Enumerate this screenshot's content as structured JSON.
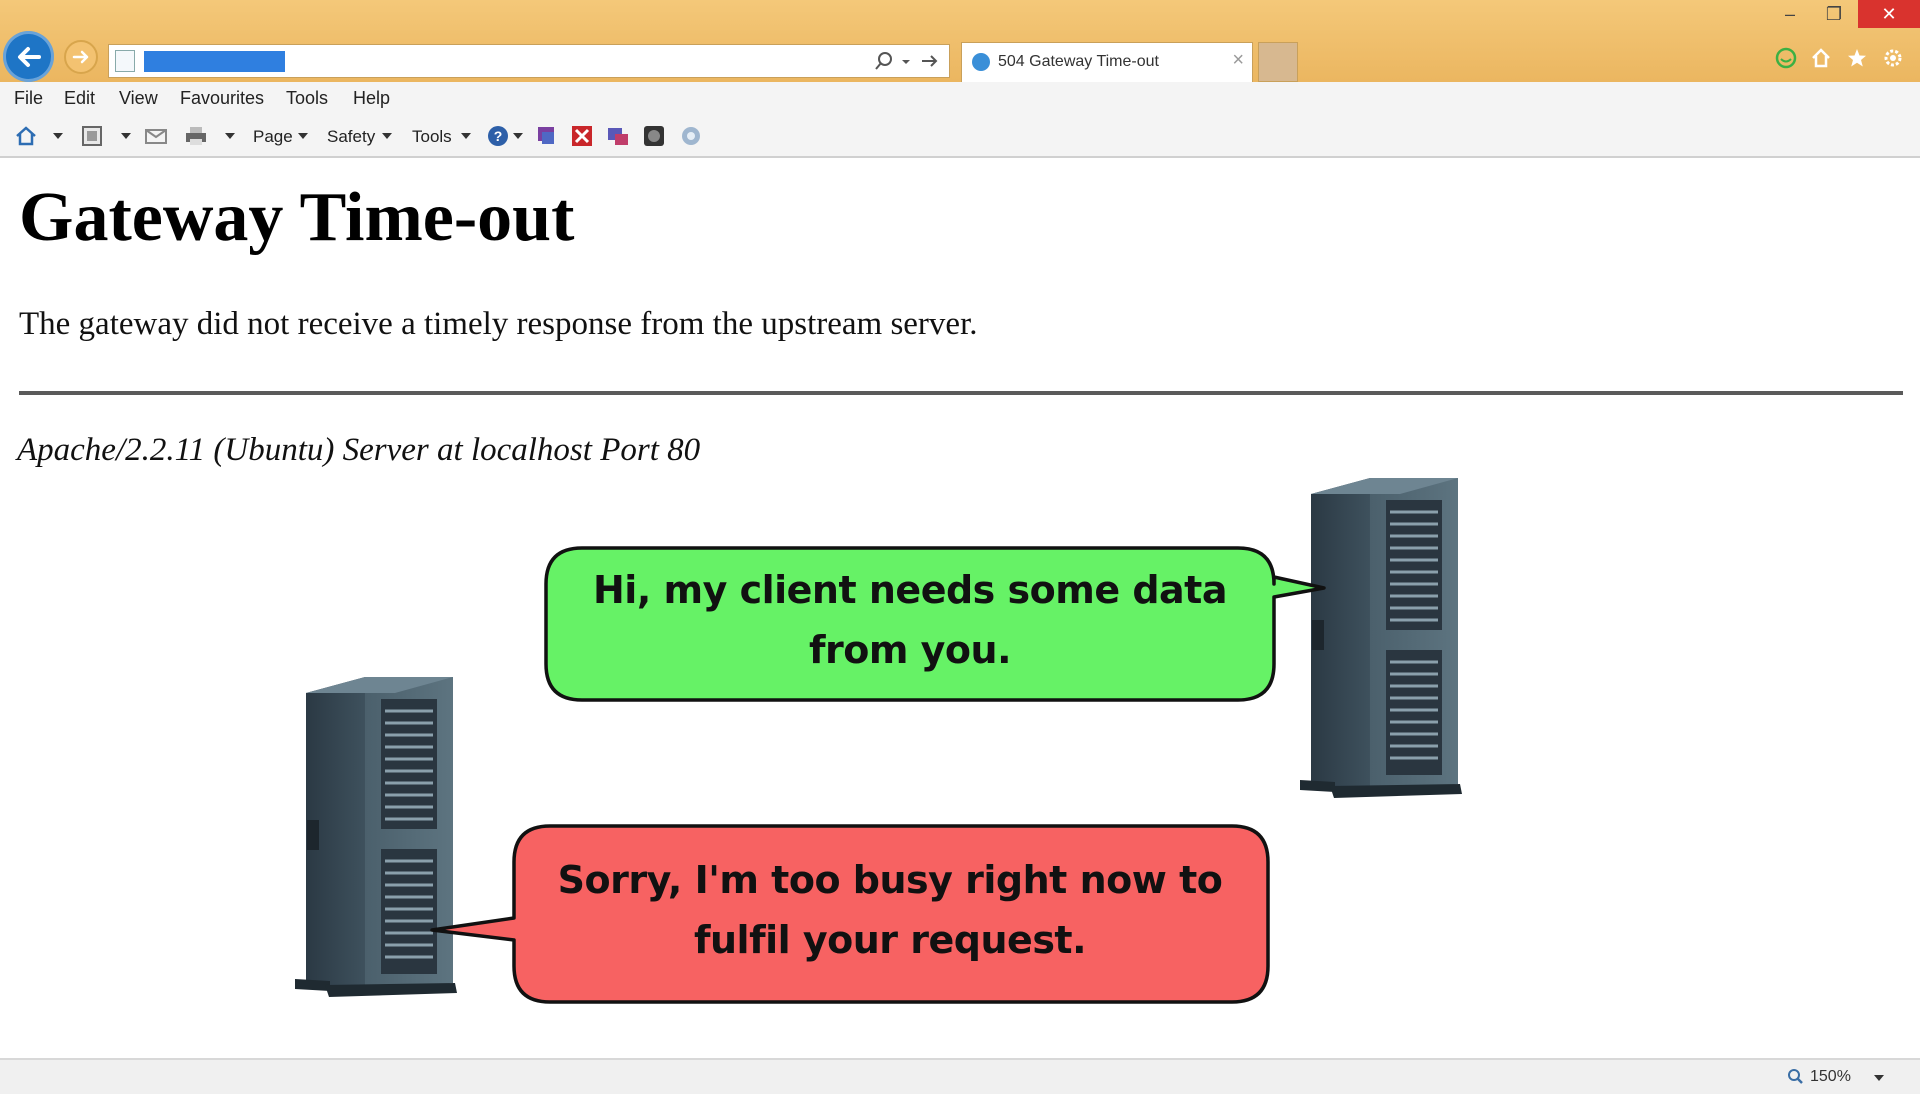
{
  "browser": {
    "tab_title": "504 Gateway Time-out",
    "tab_close": "×",
    "window_controls": {
      "minimize": "–",
      "restore": "❐",
      "close": "✕"
    },
    "menu": [
      "File",
      "Edit",
      "View",
      "Favourites",
      "Tools",
      "Help"
    ],
    "commandbar": {
      "page": "Page",
      "safety": "Safety",
      "tools": "Tools"
    },
    "zoom": "150%",
    "icons": {
      "back": "back-arrow-icon",
      "forward": "forward-arrow-icon",
      "home": "home-icon",
      "favorites": "star-icon",
      "settings": "gear-icon"
    },
    "colors": {
      "frame": "#f0c070",
      "back_button": "#1e75c6",
      "url_selection": "#2f7fe0",
      "close_button": "#d9332e"
    }
  },
  "page": {
    "heading": "Gateway Time-out",
    "message": "The gateway did not receive a timely response from the upstream server.",
    "footer": "Apache/2.2.11 (Ubuntu) Server at localhost Port 80"
  },
  "illustration": {
    "bubble_green": {
      "text": "Hi, my client needs some data from you.",
      "color": "#66f266"
    },
    "bubble_red": {
      "text": "Sorry, I'm too busy right now to fulfil your request.",
      "color": "#f76262"
    }
  }
}
